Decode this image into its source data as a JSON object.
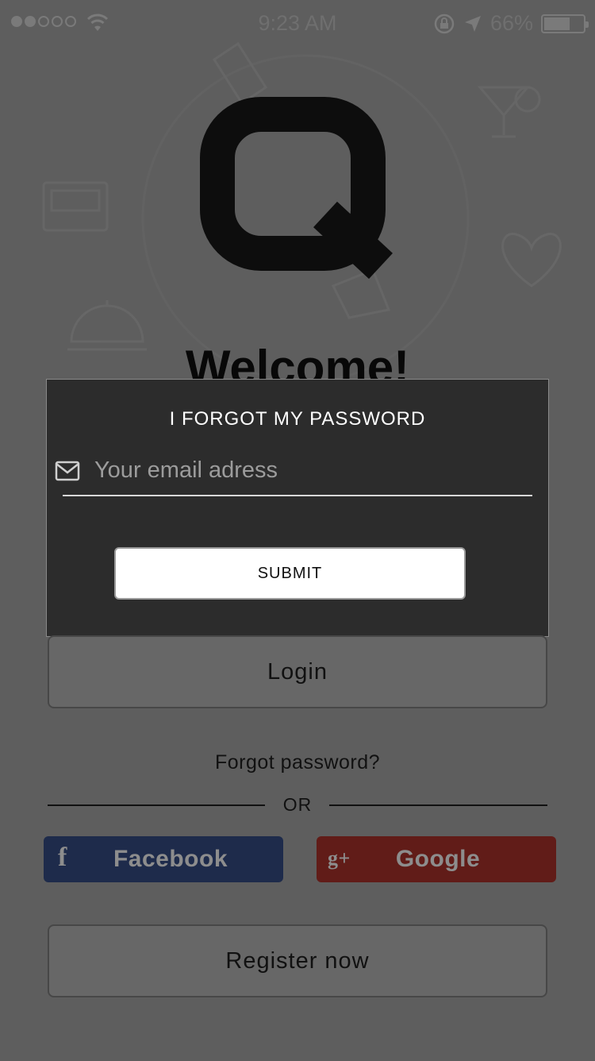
{
  "status_bar": {
    "time": "9:23 AM",
    "battery_percent_label": "66%",
    "battery_level": 0.66,
    "signal_bars_filled": 2,
    "signal_bars_total": 5
  },
  "welcome": {
    "title": "Welcome!"
  },
  "modal": {
    "title": "I FORGOT MY PASSWORD",
    "email_placeholder": "Your email adress",
    "submit_label": "SUBMIT"
  },
  "background_form": {
    "password_placeholder_visible": "Y"
  },
  "login_label": "Login",
  "forgot_label": "Forgot password?",
  "or_label": "OR",
  "social": {
    "facebook_label": "Facebook",
    "google_label": "Google",
    "facebook_icon": "f",
    "google_icon": "g+"
  },
  "register_label": "Register now",
  "colors": {
    "overlay_bg": "#5e5e5e",
    "modal_bg": "#2c2c2c",
    "facebook": "#1e2b4b",
    "google": "#611c18"
  }
}
